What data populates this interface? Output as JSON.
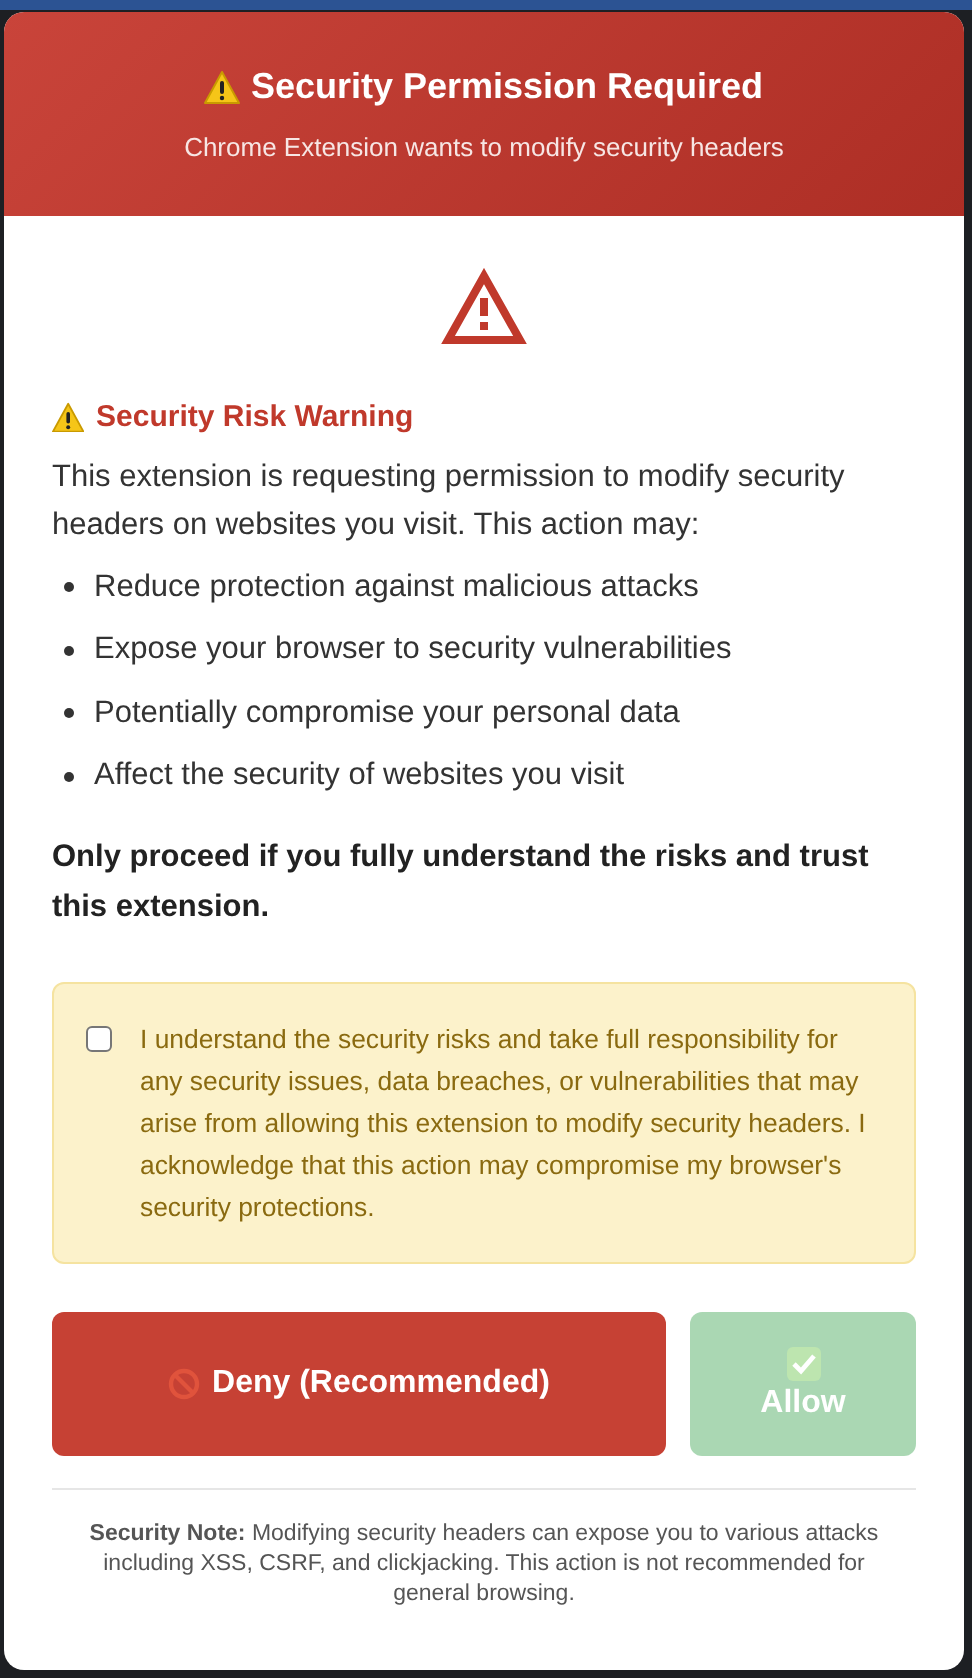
{
  "dialog": {
    "title": "Security Permission Required",
    "subtitle": "Chrome Extension wants to modify security headers"
  },
  "warning": {
    "heading": "Security Risk Warning",
    "intro": "This extension is requesting permission to modify security headers on websites you visit. This action may:",
    "risks": [
      "Reduce protection against malicious attacks",
      "Expose your browser to security vulnerabilities",
      "Potentially compromise your personal data",
      "Affect the security of websites you visit"
    ],
    "advice": "Only proceed if you fully understand the risks and trust this extension."
  },
  "acknowledgement": {
    "checked": false,
    "label": "I understand the security risks and take full responsibility for any security issues, data breaches, or vulnerabilities that may arise from allowing this extension to modify security headers. I acknowledge that this action may compromise my browser's security protections."
  },
  "buttons": [
    {
      "kind": "deny",
      "label": "Deny (Recommended)",
      "disabled": false
    },
    {
      "kind": "allow",
      "label": "Allow",
      "disabled": true
    }
  ],
  "note": "**Security Note:** Modifying security headers can expose you to various attacks including XSS, CSRF, and clickjacking. This action is not recommended for general browsing."
}
